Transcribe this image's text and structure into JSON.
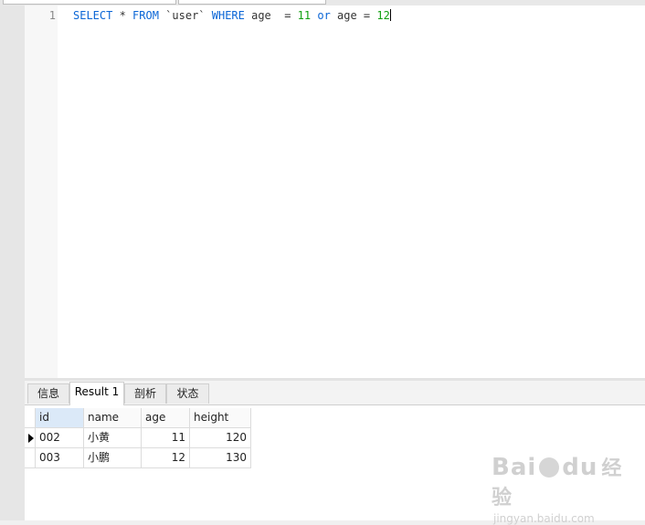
{
  "editor": {
    "line_number": "1",
    "code": {
      "t1": "SELECT",
      "t2": " * ",
      "t3": "FROM",
      "t4": " `user` ",
      "t5": "WHERE",
      "t6": " age  = ",
      "t7": "11",
      "t8": " ",
      "t9": "or",
      "t10": " age = ",
      "t11": "12"
    }
  },
  "tabs": [
    {
      "label": "信息"
    },
    {
      "label": "Result 1"
    },
    {
      "label": "剖析"
    },
    {
      "label": "状态"
    }
  ],
  "results": {
    "columns": [
      "id",
      "name",
      "age",
      "height"
    ],
    "rows": [
      [
        "002",
        "小黄",
        "11",
        "120"
      ],
      [
        "003",
        "小鹏",
        "12",
        "130"
      ]
    ]
  },
  "watermark": {
    "logo_a": "Bai",
    "logo_b": "du",
    "logo_cn": "经验",
    "url": "jingyan.baidu.com"
  },
  "colors": {
    "keyword": "#0b66d6",
    "number": "#12a012",
    "selected_header": "#dbe9f8"
  }
}
